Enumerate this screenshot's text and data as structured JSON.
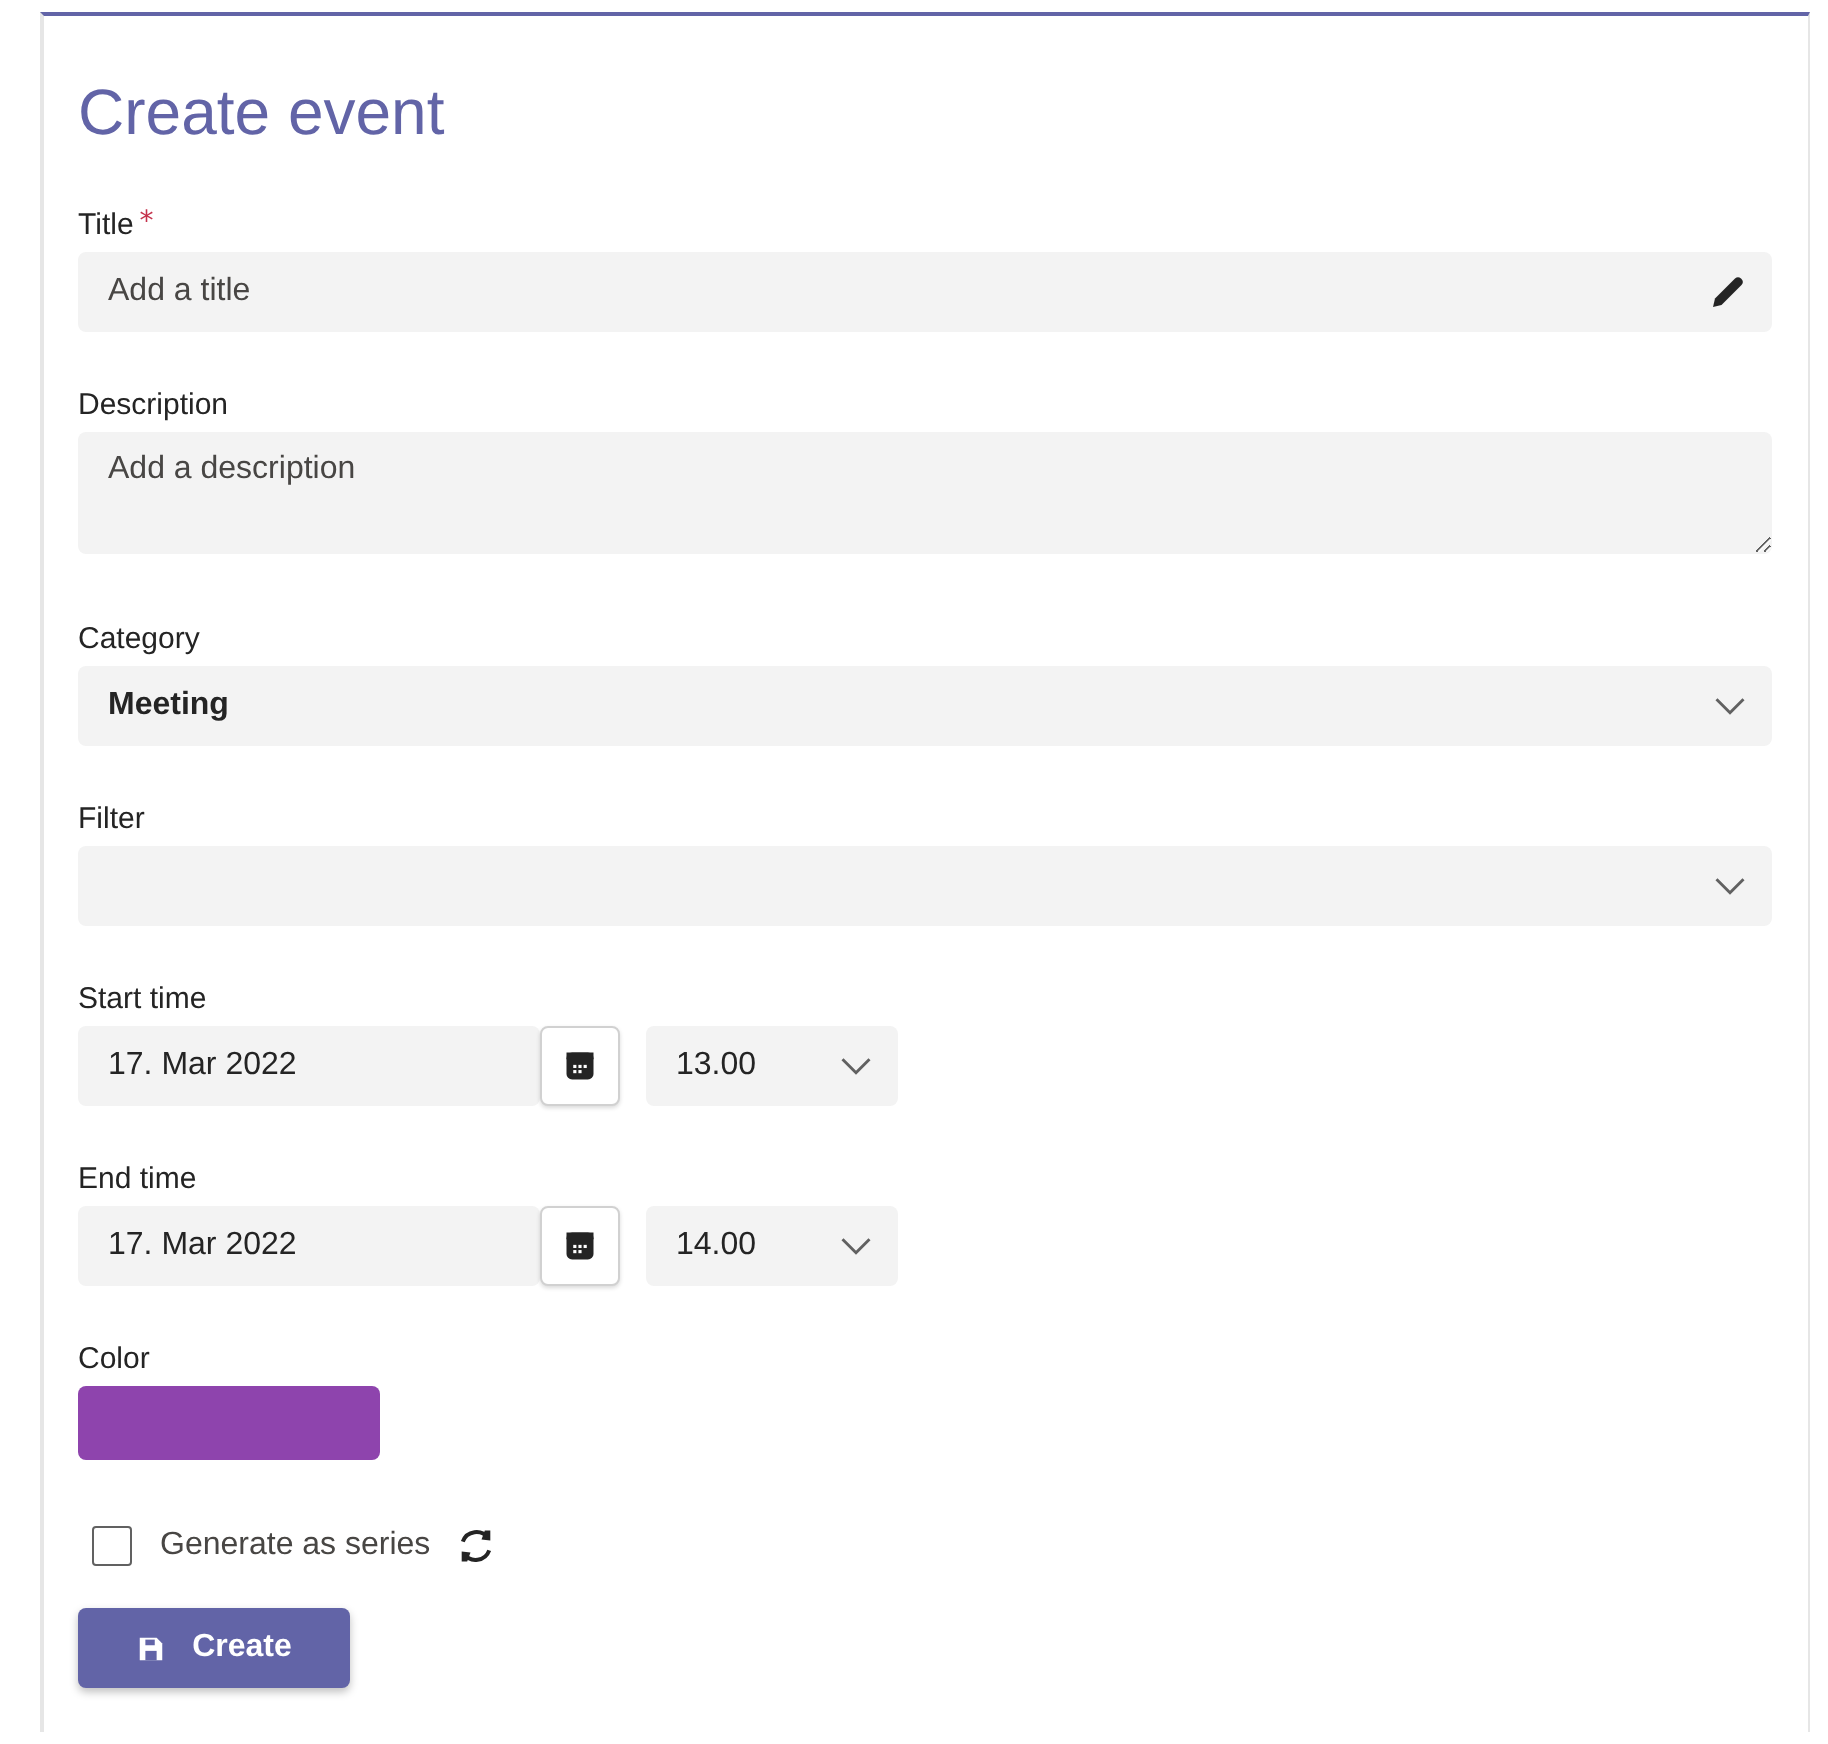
{
  "title": "Create event",
  "fields": [
    {
      "kind": "text",
      "label": "Title",
      "required_mark": "*",
      "placeholder": "Add a title"
    },
    {
      "kind": "textarea",
      "label": "Description",
      "placeholder": "Add a description"
    },
    {
      "kind": "select",
      "label": "Category",
      "value": "Meeting"
    },
    {
      "kind": "select",
      "label": "Filter"
    },
    {
      "kind": "datetime",
      "label": "Start time",
      "date": "17. Mar 2022",
      "time": "13.00"
    },
    {
      "kind": "datetime",
      "label": "End time",
      "date": "17. Mar 2022",
      "time": "14.00"
    },
    {
      "kind": "color",
      "label": "Color",
      "color": "#8e44ad"
    }
  ],
  "series": {
    "label": "Generate as series",
    "checked": false
  },
  "button": "Create"
}
